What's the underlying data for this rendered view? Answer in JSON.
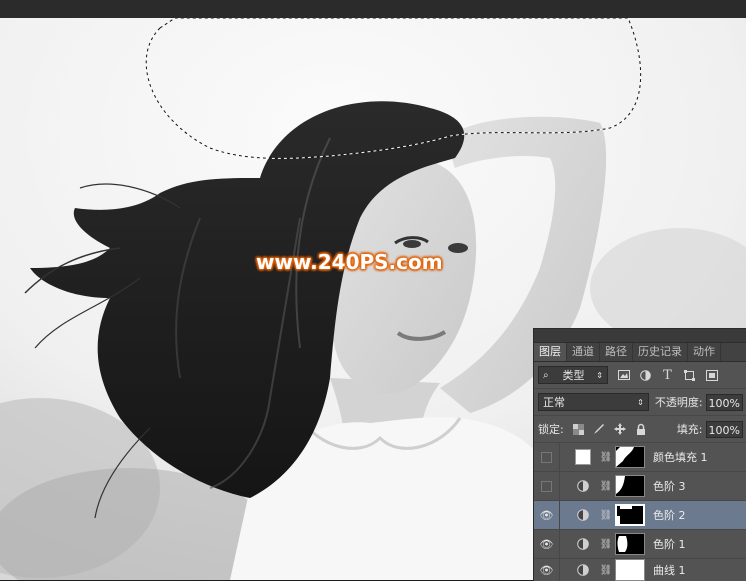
{
  "watermark": {
    "text": "www.240PS.com"
  },
  "layers_panel": {
    "tabs": [
      {
        "label": "图层",
        "active": true
      },
      {
        "label": "通道",
        "active": false
      },
      {
        "label": "路径",
        "active": false
      },
      {
        "label": "历史记录",
        "active": false
      },
      {
        "label": "动作",
        "active": false
      }
    ],
    "filter": {
      "kind_label": "类型",
      "icons": [
        "image-filter-icon",
        "adjustment-filter-icon",
        "type-filter-icon",
        "shape-filter-icon",
        "smart-object-filter-icon"
      ]
    },
    "blend_mode": "正常",
    "opacity_label": "不透明度:",
    "opacity_value": "100%",
    "lock_label": "锁定:",
    "fill_label": "填充:",
    "fill_value": "100%",
    "layers": [
      {
        "name": "颜色填充 1",
        "visible": false,
        "selected": false,
        "type": "fill"
      },
      {
        "name": "色阶 3",
        "visible": false,
        "selected": false,
        "type": "adjustment"
      },
      {
        "name": "色阶 2",
        "visible": true,
        "selected": true,
        "type": "adjustment"
      },
      {
        "name": "色阶 1",
        "visible": true,
        "selected": false,
        "type": "adjustment"
      },
      {
        "name": "曲线 1",
        "visible": true,
        "selected": false,
        "type": "adjustment"
      }
    ]
  }
}
